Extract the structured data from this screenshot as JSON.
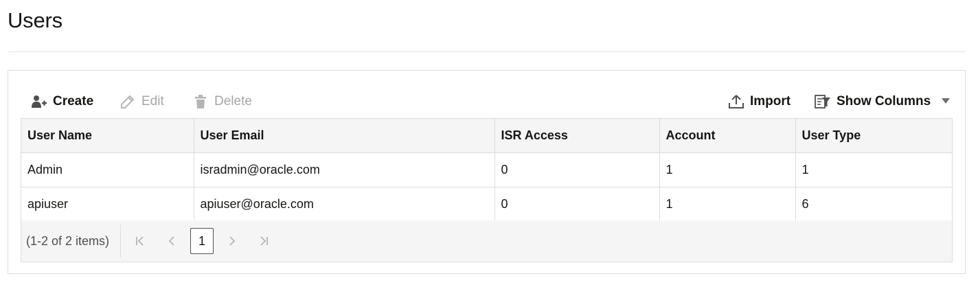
{
  "page": {
    "title": "Users"
  },
  "toolbar": {
    "create_label": "Create",
    "edit_label": "Edit",
    "delete_label": "Delete",
    "import_label": "Import",
    "show_columns_label": "Show Columns",
    "icons": {
      "create": "add-user-icon",
      "edit": "pencil-icon",
      "delete": "trash-icon",
      "import": "upload-icon",
      "show_columns": "columns-filter-icon",
      "more": "caret-down-icon"
    }
  },
  "table": {
    "columns": [
      "User Name",
      "User Email",
      "ISR Access",
      "Account",
      "User Type"
    ],
    "rows": [
      [
        "Admin",
        "isradmin@oracle.com",
        "0",
        "1",
        "1"
      ],
      [
        "apiuser",
        "apiuser@oracle.com",
        "0",
        "1",
        "6"
      ]
    ]
  },
  "pagination": {
    "summary": "(1-2 of 2 items)",
    "current_page": "1"
  },
  "colors": {
    "text": "#161513",
    "disabled": "#a6a6a6",
    "border": "#dcdcdc",
    "header_bg": "#f5f5f5"
  }
}
